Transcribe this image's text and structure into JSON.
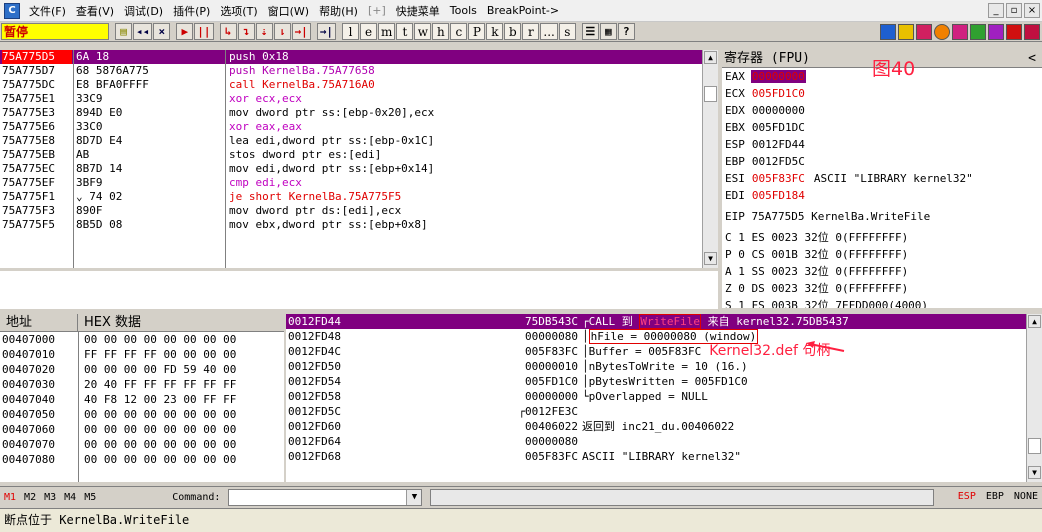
{
  "menu": {
    "items": [
      "文件(F)",
      "查看(V)",
      "调试(D)",
      "插件(P)",
      "选项(T)",
      "窗口(W)",
      "帮助(H)",
      "[+]",
      "快捷菜单",
      "Tools",
      "BreakPoint->"
    ],
    "window_buttons": [
      "_",
      "▫",
      "×"
    ]
  },
  "toolbar": {
    "status": "暂停",
    "buttons": [
      "◂◂",
      "×",
      "▶",
      "||",
      "↳",
      "↴",
      "⇣",
      "⇂",
      "→|",
      "→|"
    ],
    "letters": [
      "l",
      "e",
      "m",
      "t",
      "w",
      "h",
      "c",
      "P",
      "k",
      "b",
      "r",
      "...",
      "s"
    ],
    "help": "?"
  },
  "disasm": {
    "rows": [
      {
        "addr": "75A775D5",
        "hex": "6A 18",
        "asm": "push 0x18",
        "style": "hl"
      },
      {
        "addr": "75A775D7",
        "hex": "68 5876A775",
        "asm": "push KernelBa.75A77658",
        "style": "push"
      },
      {
        "addr": "75A775DC",
        "hex": "E8 BFA0FFFF",
        "asm": "call KernelBa.75A716A0",
        "style": "call"
      },
      {
        "addr": "75A775E1",
        "hex": "33C9",
        "asm": "xor ecx,ecx",
        "style": "normal"
      },
      {
        "addr": "75A775E3",
        "hex": "894D E0",
        "asm": "mov dword ptr ss:[ebp-0x20],ecx",
        "style": "normal"
      },
      {
        "addr": "75A775E6",
        "hex": "33C0",
        "asm": "xor eax,eax",
        "style": "normal"
      },
      {
        "addr": "75A775E8",
        "hex": "8D7D E4",
        "asm": "lea edi,dword ptr ss:[ebp-0x1C]",
        "style": "normal"
      },
      {
        "addr": "75A775EB",
        "hex": "AB",
        "asm": "stos dword ptr es:[edi]",
        "style": "normal"
      },
      {
        "addr": "75A775EC",
        "hex": "8B7D 14",
        "asm": "mov edi,dword ptr ss:[ebp+0x14]",
        "style": "normal"
      },
      {
        "addr": "75A775EF",
        "hex": "3BF9",
        "asm": "cmp edi,ecx",
        "style": "normal"
      },
      {
        "addr": "75A775F1",
        "hex": "⌄ 74 02",
        "asm": "je short KernelBa.75A775F5",
        "style": "jmp"
      },
      {
        "addr": "75A775F3",
        "hex": "890F",
        "asm": "mov dword ptr ds:[edi],ecx",
        "style": "normal"
      },
      {
        "addr": "75A775F5",
        "hex": "8B5D 08",
        "asm": "mov ebx,dword ptr ss:[ebp+0x8]",
        "style": "normal"
      }
    ]
  },
  "registers": {
    "title": "寄存器 (FPU)",
    "collapse": "<",
    "figure_label": "图40",
    "rows": [
      {
        "name": "EAX",
        "value": "00000000",
        "extra": "",
        "style": "sel"
      },
      {
        "name": "ECX",
        "value": "005FD1C0",
        "extra": "",
        "style": "red"
      },
      {
        "name": "EDX",
        "value": "00000000",
        "extra": "",
        "style": ""
      },
      {
        "name": "EBX",
        "value": "005FD1DC",
        "extra": "",
        "style": ""
      },
      {
        "name": "ESP",
        "value": "0012FD44",
        "extra": "",
        "style": ""
      },
      {
        "name": "EBP",
        "value": "0012FD5C",
        "extra": "",
        "style": ""
      },
      {
        "name": "ESI",
        "value": "005F83FC",
        "extra": "ASCII \"LIBRARY kernel32\"",
        "style": "red"
      },
      {
        "name": "EDI",
        "value": "005FD184",
        "extra": "",
        "style": "red"
      }
    ],
    "eip": "EIP 75A775D5 KernelBa.WriteFile",
    "flags": [
      "C 1   ES 0023 32位 0(FFFFFFFF)",
      "P 0   CS 001B 32位 0(FFFFFFFF)",
      "A 1   SS 0023 32位 0(FFFFFFFF)",
      "Z 0   DS 0023 32位 0(FFFFFFFF)",
      "S 1   FS 003B 32位 7EFDD000(4000)"
    ]
  },
  "dump": {
    "col_address": "地址",
    "col_hex": "HEX 数据",
    "rows": [
      {
        "addr": "00407000",
        "hex": "00 00 00 00 00 00 00 00"
      },
      {
        "addr": "00407010",
        "hex": "FF FF FF FF 00 00 00 00"
      },
      {
        "addr": "00407020",
        "hex": "00 00 00 00 FD 59 40 00"
      },
      {
        "addr": "00407030",
        "hex": "20 40 FF FF FF FF FF FF"
      },
      {
        "addr": "00407040",
        "hex": "40 F8 12 00 23 00 FF FF"
      },
      {
        "addr": "00407050",
        "hex": "00 00 00 00 00 00 00 00"
      },
      {
        "addr": "00407060",
        "hex": "00 00 00 00 00 00 00 00"
      },
      {
        "addr": "00407070",
        "hex": "00 00 00 00 00 00 00 00"
      },
      {
        "addr": "00407080",
        "hex": "00 00 00 00 00 00 00 00"
      }
    ]
  },
  "stack": {
    "rows": [
      {
        "addr": "0012FD44",
        "value": "75DB543C",
        "comment": "┌CALL 到 ",
        "tag": "WriteFile",
        "comment2": " 来自 kernel32.75DB5437",
        "style": "top"
      },
      {
        "addr": "0012FD48",
        "value": "00000080",
        "comment": "│",
        "boxed": "hFile = 00000080 (window)",
        "style": ""
      },
      {
        "addr": "0012FD4C",
        "value": "005F83FC",
        "comment": "│Buffer = 005F83FC",
        "note": "Kernel32.def 句柄",
        "style": ""
      },
      {
        "addr": "0012FD50",
        "value": "00000010",
        "comment": "│nBytesToWrite = 10 (16.)",
        "style": ""
      },
      {
        "addr": "0012FD54",
        "value": "005FD1C0",
        "comment": "│pBytesWritten = 005FD1C0",
        "style": ""
      },
      {
        "addr": "0012FD58",
        "value": "00000000",
        "comment": "└pOverlapped = NULL",
        "style": ""
      },
      {
        "addr": "0012FD5C",
        "value": "┌0012FE3C",
        "comment": "",
        "style": ""
      },
      {
        "addr": "0012FD60",
        "value": "00406022",
        "comment": "返回到 inc21_du.00406022",
        "style": ""
      },
      {
        "addr": "0012FD64",
        "value": "00000080",
        "comment": "",
        "style": ""
      },
      {
        "addr": "0012FD68",
        "value": "005F83FC",
        "comment": "ASCII \"LIBRARY kernel32\"",
        "style": ""
      }
    ]
  },
  "bottom": {
    "marks": [
      "M1",
      "M2",
      "M3",
      "M4",
      "M5"
    ],
    "command_label": "Command:",
    "reg_modes": [
      "ESP",
      "EBP",
      "NONE"
    ]
  },
  "status": "断点位于 KernelBa.WriteFile"
}
